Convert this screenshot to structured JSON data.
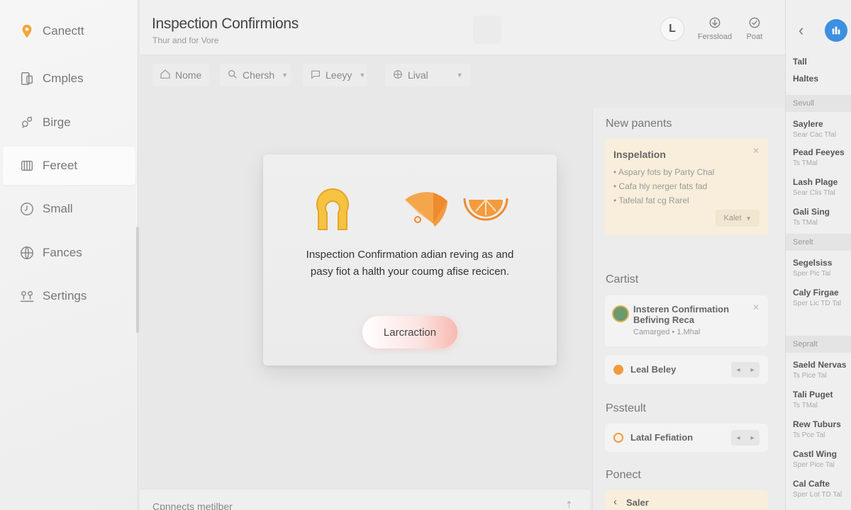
{
  "sidebar": {
    "items": [
      {
        "label": "Canectt",
        "icon": "location-pin-icon"
      },
      {
        "label": "Cmples",
        "icon": "document-icon"
      },
      {
        "label": "Birge",
        "icon": "gears-icon"
      },
      {
        "label": "Fereet",
        "icon": "layers-icon"
      },
      {
        "label": "Small",
        "icon": "clock-icon"
      },
      {
        "label": "Fances",
        "icon": "globe-icon"
      },
      {
        "label": "Sertings",
        "icon": "users-icon"
      }
    ]
  },
  "header": {
    "title": "Inspection Confirmions",
    "subtitle": "Thur and for Vore",
    "avatar_letter": "L",
    "btn1_label": "Ferssload",
    "btn2_label": "Poat"
  },
  "filters": {
    "f1": "Nome",
    "f2": "Chersh",
    "f3": "Leeyy",
    "f4": "Lival"
  },
  "panel": {
    "sec1": "New panents",
    "card1": {
      "title": "Inspelation",
      "bullets": [
        "Aspary fots by Party Chal",
        "Cafa hly nerger fats fad",
        "Tafelal fat cg Rarel"
      ],
      "select": "Kalet"
    },
    "sec2": "Cartist",
    "card2": {
      "title": "Insteren Confirmation",
      "title2": "Befiving Reca",
      "meta": "Camarged • 1.Mhal"
    },
    "card3": {
      "title": "Leal Beley"
    },
    "sec3": "Pssteult",
    "card4": {
      "title": "Latal Fefiation"
    },
    "sec4": "Ponect",
    "card5": {
      "title": "Saler"
    }
  },
  "farlist": {
    "head1": "Tall",
    "head2": "Haltes",
    "sec1": "Sevull",
    "items1": [
      {
        "a": "Saylere",
        "b": "Sear Cac Tfal"
      },
      {
        "a": "Pead Feeyes",
        "b": "Ts TMal"
      },
      {
        "a": "Lash Plage",
        "b": "Sear Clis Tfal"
      },
      {
        "a": "Gali Sing",
        "b": "Ts TMal"
      }
    ],
    "sec2": "Serelt",
    "items2": [
      {
        "a": "Segelsiss",
        "b": "Sper Pic Tal"
      },
      {
        "a": "Caly Firgae",
        "b": "Sper Lic TD Tal"
      }
    ],
    "sec3": "Sepralt",
    "items3": [
      {
        "a": "Saeld Nervas",
        "b": "Ts Pice Tal"
      },
      {
        "a": "Tali Puget",
        "b": "Ts TMal"
      },
      {
        "a": "Rew Tuburs",
        "b": "Ts Pce Tal"
      },
      {
        "a": "Castl Wing",
        "b": "Sper Pice Tal"
      },
      {
        "a": "Cal Cafte",
        "b": "Sper Lot TD Tal"
      }
    ]
  },
  "bottombar": {
    "label": "Cpnnects metilber"
  },
  "modal": {
    "text_line1": "Inspection Confirmation adian reving as and",
    "text_line2": "pasy fiot a halth your coumg afise recicen.",
    "button_label": "Larcraction"
  },
  "colors": {
    "accent_orange": "#f19a3e",
    "accent_yellow": "#f6c242",
    "accent_blue": "#3d8fe0"
  }
}
